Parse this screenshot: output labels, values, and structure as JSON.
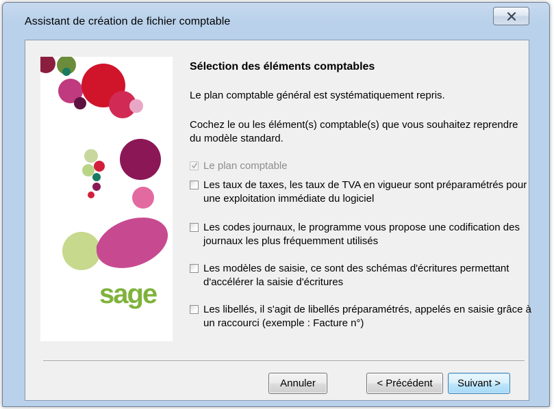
{
  "window": {
    "title": "Assistant de création de fichier comptable",
    "close_icon": "close-icon"
  },
  "side_panel": {
    "logo_text": "sage",
    "logo_color": "#7fb23c"
  },
  "content": {
    "heading": "Sélection des éléments comptables",
    "line1": "Le plan comptable général est systématiquement repris.",
    "paragraph": "Cochez le ou les élément(s) comptable(s) que vous souhaitez reprendre du modèle standard."
  },
  "options": [
    {
      "label": "Le plan comptable",
      "checked": true,
      "disabled": true
    },
    {
      "label": "Les taux de taxes, les taux de TVA en vigueur sont préparamétrés pour une exploitation immédiate du logiciel",
      "checked": false,
      "disabled": false
    },
    {
      "label": "Les codes journaux, le programme vous propose une codification des journaux les plus fréquemment utilisés",
      "checked": false,
      "disabled": false
    },
    {
      "label": "Les modèles de saisie, ce sont des schémas d'écritures permettant d'accélérer la saisie d'écritures",
      "checked": false,
      "disabled": false
    },
    {
      "label": "Les libellés, il s'agit de libellés préparamétrés, appelés en saisie grâce à un raccourci (exemple : Facture n°)",
      "checked": false,
      "disabled": false
    }
  ],
  "buttons": {
    "cancel": "Annuler",
    "previous": "< Précédent",
    "next": "Suivant >"
  }
}
